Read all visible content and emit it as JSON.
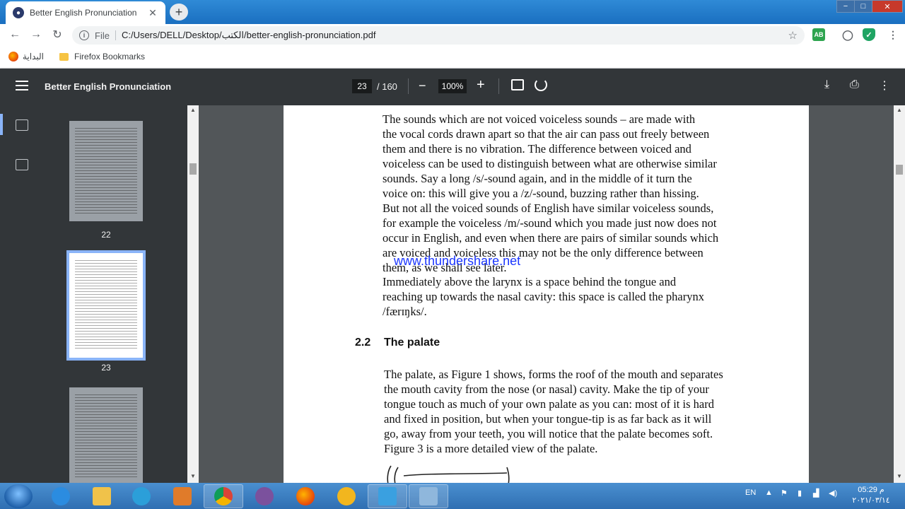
{
  "browser": {
    "tab_title": "Better English Pronunciation",
    "new_tab": "+",
    "close_tab": "✕",
    "scheme": "File",
    "url": "C:/Users/DELL/Desktop/الكتب/better-english-pronunciation.pdf",
    "ext_ab": "AB",
    "window": {
      "minimize": "−",
      "maximize": "□",
      "close": "✕"
    }
  },
  "bookmarks": [
    {
      "label": "البداية"
    },
    {
      "label": "Firefox Bookmarks"
    }
  ],
  "viewer": {
    "title": "Better English Pronunciation",
    "page_current": "23",
    "page_total": "/ 160",
    "zoom": "100%",
    "zoom_out": "−",
    "zoom_in": "+",
    "download": "⤓",
    "print": "⎙",
    "more": "⋮"
  },
  "thumbnails": [
    {
      "label": "22"
    },
    {
      "label": "23"
    },
    {
      "label": ""
    }
  ],
  "page": {
    "lines_top": [
      "The sounds which are not voiced   voiceless sounds – are made with",
      "the vocal cords drawn apart so that the air can pass out freely between",
      "them and there is no vibration. The difference between voiced and",
      "voiceless can be used to distinguish between what are otherwise similar",
      "sounds. Say a long /s/-sound again, and in the middle of it turn the",
      "voice on: this will give you a /z/-sound, buzzing rather than hissing.",
      "But not all the voiced sounds of English have similar voiceless sounds,",
      "for example the voiceless /m/-sound which you made just now does not",
      "occur in English, and even when there are pairs of similar sounds which",
      "are voiced and voiceless this may not be the only difference between",
      "them, as we shall see later.",
      "   Immediately above the larynx is a space behind the tongue and",
      "reaching up towards the nasal cavity: this space is called the pharynx",
      "/færɪŋks/."
    ],
    "section_number": "2.2",
    "section_title": "The palate",
    "lines_bottom": [
      "The palate, as Figure 1 shows, forms the roof of the mouth and separates",
      "the mouth cavity from the nose (or nasal) cavity. Make the tip of your",
      "tongue touch as much of your own palate as you can: most of it is hard",
      "and fixed in position, but when your tongue-tip is as far back as it will",
      "go, away from your teeth, you will notice that the palate becomes soft.",
      "Figure 3 is a more detailed view of the palate."
    ],
    "watermark": "www.thundershare.net"
  },
  "taskbar": {
    "lang": "EN",
    "time": "05:29 م",
    "date": "٢٠٢١/٠٣/١٤"
  }
}
